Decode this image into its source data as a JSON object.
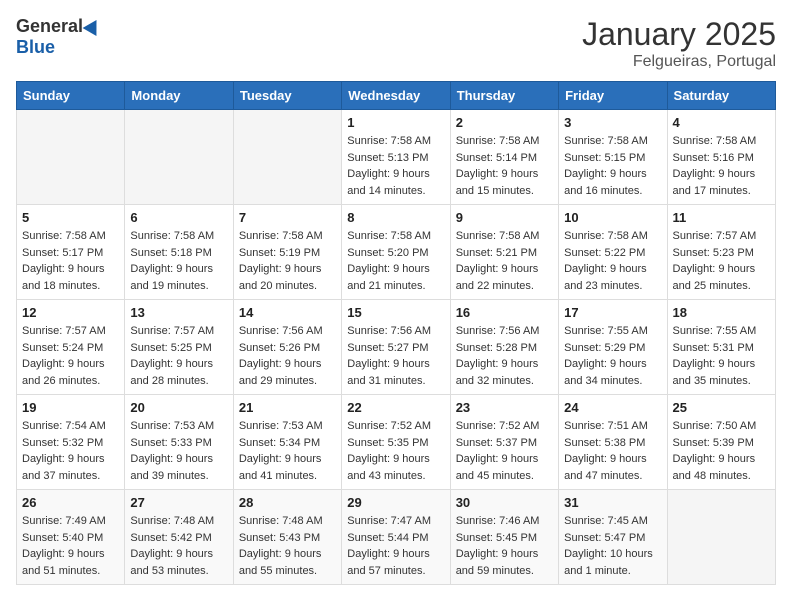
{
  "header": {
    "logo_general": "General",
    "logo_blue": "Blue",
    "month_title": "January 2025",
    "location": "Felgueiras, Portugal"
  },
  "weekdays": [
    "Sunday",
    "Monday",
    "Tuesday",
    "Wednesday",
    "Thursday",
    "Friday",
    "Saturday"
  ],
  "weeks": [
    [
      {
        "day": "",
        "info": ""
      },
      {
        "day": "",
        "info": ""
      },
      {
        "day": "",
        "info": ""
      },
      {
        "day": "1",
        "info": "Sunrise: 7:58 AM\nSunset: 5:13 PM\nDaylight: 9 hours\nand 14 minutes."
      },
      {
        "day": "2",
        "info": "Sunrise: 7:58 AM\nSunset: 5:14 PM\nDaylight: 9 hours\nand 15 minutes."
      },
      {
        "day": "3",
        "info": "Sunrise: 7:58 AM\nSunset: 5:15 PM\nDaylight: 9 hours\nand 16 minutes."
      },
      {
        "day": "4",
        "info": "Sunrise: 7:58 AM\nSunset: 5:16 PM\nDaylight: 9 hours\nand 17 minutes."
      }
    ],
    [
      {
        "day": "5",
        "info": "Sunrise: 7:58 AM\nSunset: 5:17 PM\nDaylight: 9 hours\nand 18 minutes."
      },
      {
        "day": "6",
        "info": "Sunrise: 7:58 AM\nSunset: 5:18 PM\nDaylight: 9 hours\nand 19 minutes."
      },
      {
        "day": "7",
        "info": "Sunrise: 7:58 AM\nSunset: 5:19 PM\nDaylight: 9 hours\nand 20 minutes."
      },
      {
        "day": "8",
        "info": "Sunrise: 7:58 AM\nSunset: 5:20 PM\nDaylight: 9 hours\nand 21 minutes."
      },
      {
        "day": "9",
        "info": "Sunrise: 7:58 AM\nSunset: 5:21 PM\nDaylight: 9 hours\nand 22 minutes."
      },
      {
        "day": "10",
        "info": "Sunrise: 7:58 AM\nSunset: 5:22 PM\nDaylight: 9 hours\nand 23 minutes."
      },
      {
        "day": "11",
        "info": "Sunrise: 7:57 AM\nSunset: 5:23 PM\nDaylight: 9 hours\nand 25 minutes."
      }
    ],
    [
      {
        "day": "12",
        "info": "Sunrise: 7:57 AM\nSunset: 5:24 PM\nDaylight: 9 hours\nand 26 minutes."
      },
      {
        "day": "13",
        "info": "Sunrise: 7:57 AM\nSunset: 5:25 PM\nDaylight: 9 hours\nand 28 minutes."
      },
      {
        "day": "14",
        "info": "Sunrise: 7:56 AM\nSunset: 5:26 PM\nDaylight: 9 hours\nand 29 minutes."
      },
      {
        "day": "15",
        "info": "Sunrise: 7:56 AM\nSunset: 5:27 PM\nDaylight: 9 hours\nand 31 minutes."
      },
      {
        "day": "16",
        "info": "Sunrise: 7:56 AM\nSunset: 5:28 PM\nDaylight: 9 hours\nand 32 minutes."
      },
      {
        "day": "17",
        "info": "Sunrise: 7:55 AM\nSunset: 5:29 PM\nDaylight: 9 hours\nand 34 minutes."
      },
      {
        "day": "18",
        "info": "Sunrise: 7:55 AM\nSunset: 5:31 PM\nDaylight: 9 hours\nand 35 minutes."
      }
    ],
    [
      {
        "day": "19",
        "info": "Sunrise: 7:54 AM\nSunset: 5:32 PM\nDaylight: 9 hours\nand 37 minutes."
      },
      {
        "day": "20",
        "info": "Sunrise: 7:53 AM\nSunset: 5:33 PM\nDaylight: 9 hours\nand 39 minutes."
      },
      {
        "day": "21",
        "info": "Sunrise: 7:53 AM\nSunset: 5:34 PM\nDaylight: 9 hours\nand 41 minutes."
      },
      {
        "day": "22",
        "info": "Sunrise: 7:52 AM\nSunset: 5:35 PM\nDaylight: 9 hours\nand 43 minutes."
      },
      {
        "day": "23",
        "info": "Sunrise: 7:52 AM\nSunset: 5:37 PM\nDaylight: 9 hours\nand 45 minutes."
      },
      {
        "day": "24",
        "info": "Sunrise: 7:51 AM\nSunset: 5:38 PM\nDaylight: 9 hours\nand 47 minutes."
      },
      {
        "day": "25",
        "info": "Sunrise: 7:50 AM\nSunset: 5:39 PM\nDaylight: 9 hours\nand 48 minutes."
      }
    ],
    [
      {
        "day": "26",
        "info": "Sunrise: 7:49 AM\nSunset: 5:40 PM\nDaylight: 9 hours\nand 51 minutes."
      },
      {
        "day": "27",
        "info": "Sunrise: 7:48 AM\nSunset: 5:42 PM\nDaylight: 9 hours\nand 53 minutes."
      },
      {
        "day": "28",
        "info": "Sunrise: 7:48 AM\nSunset: 5:43 PM\nDaylight: 9 hours\nand 55 minutes."
      },
      {
        "day": "29",
        "info": "Sunrise: 7:47 AM\nSunset: 5:44 PM\nDaylight: 9 hours\nand 57 minutes."
      },
      {
        "day": "30",
        "info": "Sunrise: 7:46 AM\nSunset: 5:45 PM\nDaylight: 9 hours\nand 59 minutes."
      },
      {
        "day": "31",
        "info": "Sunrise: 7:45 AM\nSunset: 5:47 PM\nDaylight: 10 hours\nand 1 minute."
      },
      {
        "day": "",
        "info": ""
      }
    ]
  ]
}
